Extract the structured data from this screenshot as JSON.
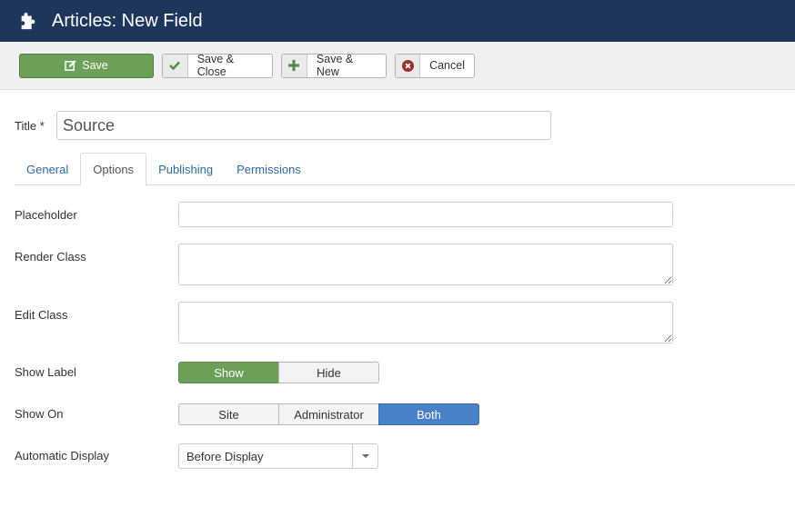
{
  "header": {
    "title": "Articles: New Field",
    "icon": "puzzle-icon"
  },
  "toolbar": {
    "save": "Save",
    "save_close": "Save & Close",
    "save_new": "Save & New",
    "cancel": "Cancel"
  },
  "title_field": {
    "label": "Title *",
    "value": "Source"
  },
  "tabs": [
    {
      "label": "General",
      "active": false
    },
    {
      "label": "Options",
      "active": true
    },
    {
      "label": "Publishing",
      "active": false
    },
    {
      "label": "Permissions",
      "active": false
    }
  ],
  "form": {
    "placeholder": {
      "label": "Placeholder",
      "value": ""
    },
    "render_class": {
      "label": "Render Class",
      "value": ""
    },
    "edit_class": {
      "label": "Edit Class",
      "value": ""
    },
    "show_label": {
      "label": "Show Label",
      "options": [
        "Show",
        "Hide"
      ],
      "selected": "Show"
    },
    "show_on": {
      "label": "Show On",
      "options": [
        "Site",
        "Administrator",
        "Both"
      ],
      "selected": "Both"
    },
    "automatic_display": {
      "label": "Automatic Display",
      "value": "Before Display"
    }
  },
  "colors": {
    "header_bg": "#1f365c",
    "success": "#6c9f58",
    "primary": "#4a80c8",
    "danger": "#9b2f2a"
  }
}
